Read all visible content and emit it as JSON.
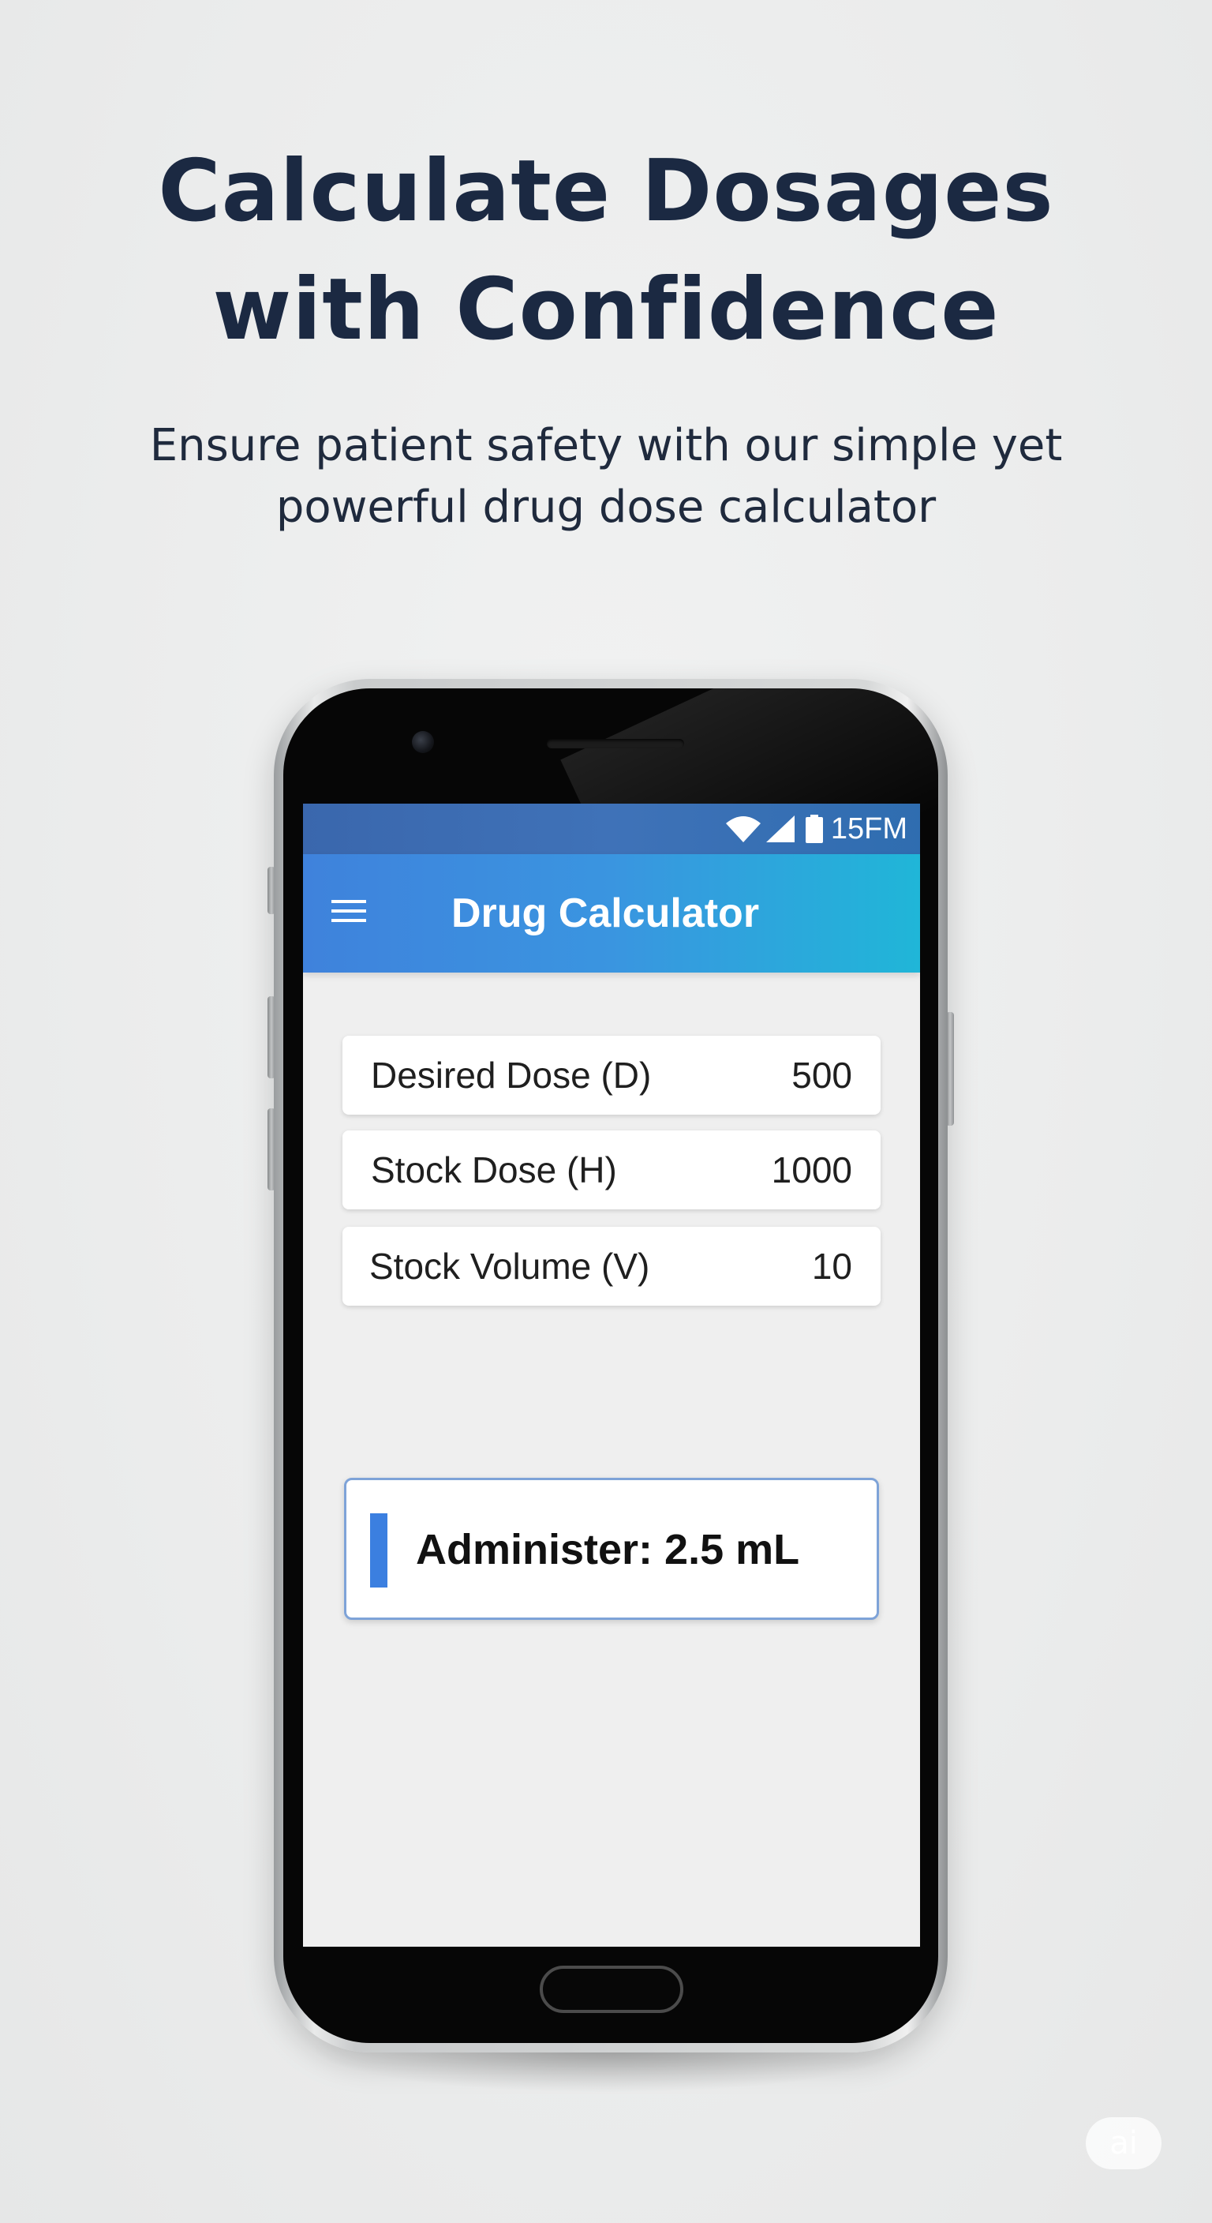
{
  "promo": {
    "headline_line1": "Calculate Dosages",
    "headline_line2": "with Confidence",
    "subtitle_line1": "Ensure patient safety with our simple yet",
    "subtitle_line2": "powerful drug dose calculator"
  },
  "status_bar": {
    "time": "15FM",
    "icons": [
      "wifi-icon",
      "signal-icon",
      "battery-icon"
    ]
  },
  "app_bar": {
    "title": "Drug Calculator",
    "menu_icon": "hamburger-menu-icon"
  },
  "inputs": [
    {
      "label": "Desired Dose (D)",
      "value": "500"
    },
    {
      "label": "Stock Dose (H)",
      "value": "1000"
    },
    {
      "label": "Stock Volume (V)",
      "value": "10"
    }
  ],
  "result": {
    "text": "Administer: 2.5 mL"
  },
  "colors": {
    "headline": "#1b2942",
    "app_bar_start": "#3f82dc",
    "app_bar_end": "#20b6d8",
    "status_bar": "#3a67ad",
    "result_accent": "#3b7fe0",
    "result_border": "#7ea3d8"
  },
  "watermark": {
    "text": "ai"
  }
}
